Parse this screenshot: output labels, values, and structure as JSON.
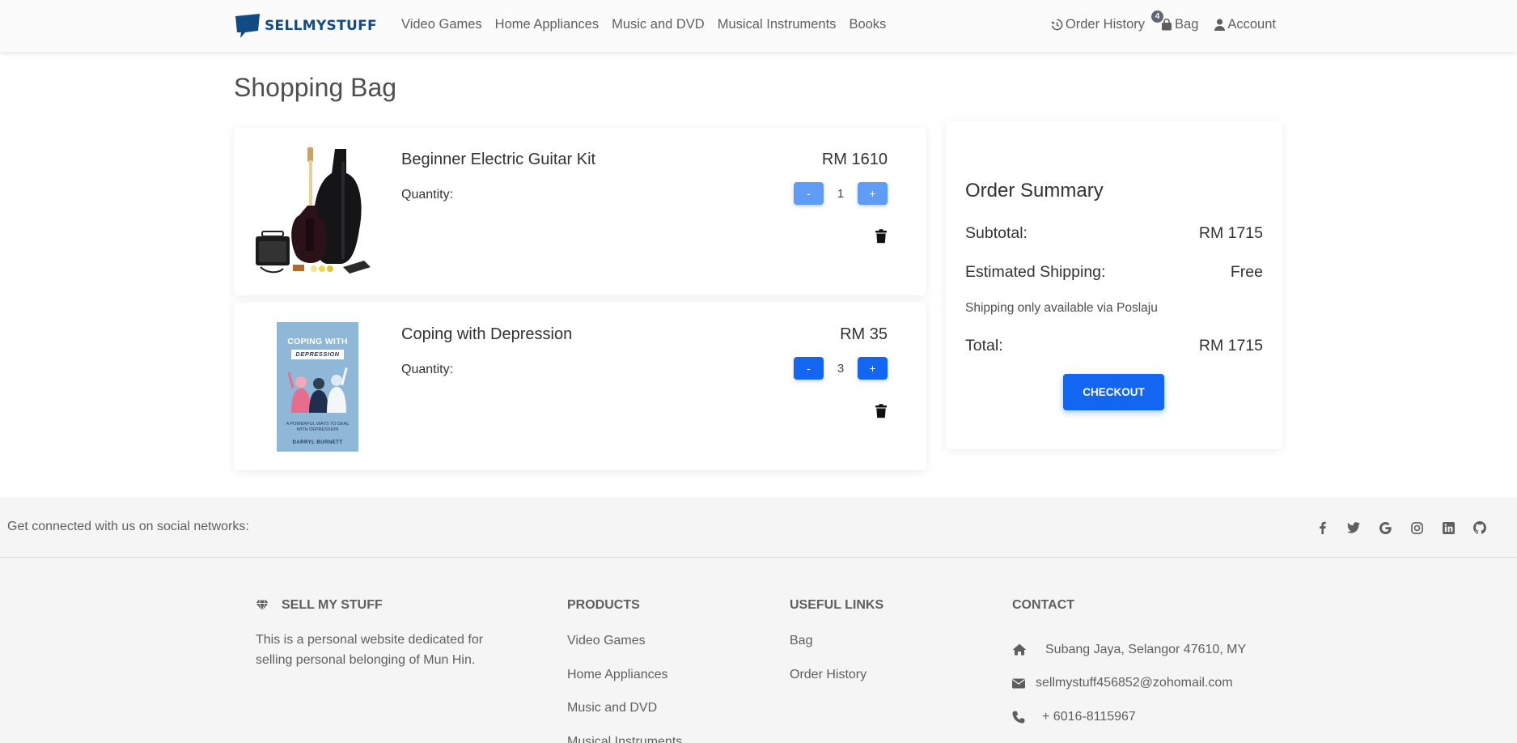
{
  "brand": {
    "name": "SELLMYSTUFF",
    "color": "#124a84"
  },
  "nav": {
    "links": [
      "Video Games",
      "Home Appliances",
      "Music and DVD",
      "Musical Instruments",
      "Books"
    ],
    "order_history": "Order History",
    "bag": "Bag",
    "bag_count": "4",
    "account": "Account"
  },
  "page_title": "Shopping Bag",
  "cart": {
    "items": [
      {
        "name": "Beginner Electric Guitar Kit",
        "price": "RM 1610",
        "quantity_label": "Quantity:",
        "quantity": "1",
        "minus": "-",
        "plus": "+",
        "image": "electric-guitar-kit"
      },
      {
        "name": "Coping with Depression",
        "price": "RM 35",
        "quantity_label": "Quantity:",
        "quantity": "3",
        "minus": "-",
        "plus": "+",
        "image": "book-cover"
      }
    ]
  },
  "book_cover": {
    "title_top": "COPING WITH",
    "title_box": "DEPRESSION",
    "subtitle": "A POWERFUL WAYS TO DEAL WITH DEPRESSION",
    "author": "DARRYL BURNETT"
  },
  "summary": {
    "title": "Order Summary",
    "subtotal_label": "Subtotal:",
    "subtotal_value": "RM 1715",
    "shipping_label": "Estimated Shipping:",
    "shipping_value": "Free",
    "note": "Shipping only available via Poslaju",
    "total_label": "Total:",
    "total_value": "RM 1715",
    "checkout": "CHECKOUT"
  },
  "footer": {
    "social_text": "Get connected with us on social networks:",
    "social_icons": [
      "facebook-icon",
      "twitter-icon",
      "google-icon",
      "instagram-icon",
      "linkedin-icon",
      "github-icon"
    ],
    "about_title": "SELL MY STUFF",
    "about_text": "This is a personal website dedicated for selling personal belonging of Mun Hin.",
    "products_title": "PRODUCTS",
    "products": [
      "Video Games",
      "Home Appliances",
      "Music and DVD",
      "Musical Instruments"
    ],
    "useful_title": "USEFUL LINKS",
    "useful": [
      "Bag",
      "Order History"
    ],
    "contact_title": "CONTACT",
    "address": "Subang Jaya, Selangor 47610, MY",
    "email": "sellmystuff456852@zohomail.com",
    "phone": "+ 6016-8115967"
  },
  "colors": {
    "primary": "#1266f1",
    "primary_disabled": "#5e9cf5",
    "footer_bg": "#f5f5f5"
  }
}
